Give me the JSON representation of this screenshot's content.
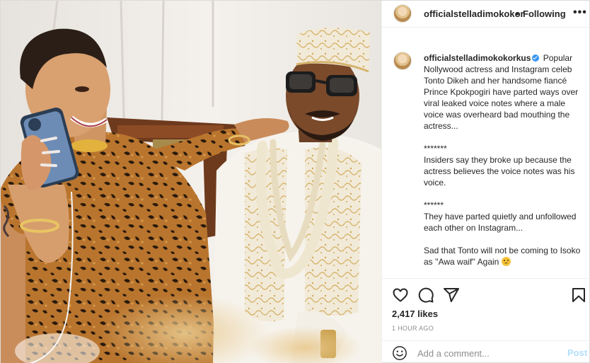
{
  "header": {
    "username": "officialstelladimokokor",
    "separator": "•",
    "follow_status": "Following",
    "more_icon": "more-horizontal-icon",
    "more_label": "•••"
  },
  "caption": {
    "username": "officialstelladimokokorkus",
    "verified_icon": "verified-badge-icon",
    "text_intro": "Popular Nollywood actress and Instagram celeb Tonto Dikeh and her handsome fiancé Prince Kpokpogiri have parted ways over viral leaked voice notes where a male voice was overheard bad mouthing the actress...",
    "separator_1": "*******",
    "paragraph_2": "Insiders say they broke up because the actress believes the voice notes was his voice.",
    "separator_2": "******",
    "paragraph_3": "They have parted quietly and unfollowed each other on Instagram...",
    "paragraph_4": "Sad that Tonto will not be coming to Isoko as ''Awa waif'' Again",
    "emoji_icon": "sad-face-emoji"
  },
  "actions": {
    "icons": [
      "heart-icon",
      "comment-icon",
      "share-icon",
      "bookmark-icon"
    ],
    "likes": "2,417 likes",
    "time_ago": "1 HOUR AGO"
  },
  "comment_box": {
    "placeholder": "Add a comment...",
    "post_label": "Post",
    "emoji_icon": "smiley-icon"
  },
  "colors": {
    "verified": "#3897f0",
    "post_disabled": "#b2dffc",
    "muted_text": "#8e8e8e",
    "border": "#dbdbdb"
  }
}
